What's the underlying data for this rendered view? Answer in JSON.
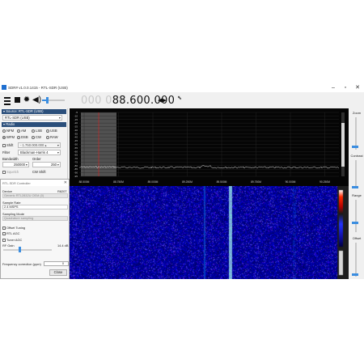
{
  "titlebar": {
    "title": "SDR# v1.0.0.1415 - RTL-SDR (USB)",
    "minimize": "–",
    "maximize": "▫",
    "close": "✕"
  },
  "toolbar": {
    "freq_dim": "000 0",
    "freq_main": "88.600.000",
    "freq_arrows": "◀▶"
  },
  "source": {
    "header": "▾  Source: RTL-SDR (USB)",
    "value": "RTL-SDR (USB)"
  },
  "radio": {
    "header": "▾  Radio",
    "modes": [
      {
        "label": "NFM",
        "on": false
      },
      {
        "label": "AM",
        "on": false
      },
      {
        "label": "LSB",
        "on": false
      },
      {
        "label": "USB",
        "on": false
      },
      {
        "label": "WFM",
        "on": true
      },
      {
        "label": "DSB",
        "on": false
      },
      {
        "label": "CW",
        "on": false
      },
      {
        "label": "RAW",
        "on": false
      }
    ],
    "shift_label": "Shift",
    "shift_value": "- 1.750.000.000 ▴",
    "filter_label": "Filter",
    "filter_value": "Blackman-Harris 4",
    "bandwidth_label": "Bandwidth",
    "order_label": "Order",
    "bandwidth_value": "250000",
    "order_value": "250",
    "squelch_label": "Squelch",
    "cw_shift_label": "CW Shift"
  },
  "dialog": {
    "title": "RTL-SDR Controller",
    "close": "✕",
    "device_label": "Device",
    "device_id": "R820T",
    "device_value": "Generic RTL2832U OEM (0)",
    "sample_rate_label": "Sample Rate",
    "sample_rate_value": "2.4 MSPS",
    "sampling_mode_label": "Sampling Mode",
    "sampling_mode_value": "Quadrature sampling",
    "offset_tuning": "Offset Tuning",
    "rtl_agc": "RTL AGC",
    "tuner_agc": "Tuner AGC",
    "rf_gain_label": "RF Gain",
    "rf_gain_value": "14.4 dB",
    "rf_gain_level": 0.33,
    "freq_correction_label": "Frequency correction (ppm)",
    "freq_correction_value": "0",
    "close_button": "Close"
  },
  "spectrum": {
    "db_ticks": [
      "-5",
      "-10",
      "-15",
      "-20",
      "-25",
      "-30",
      "-35",
      "-40",
      "-45",
      "-50",
      "-55",
      "-60",
      "-65",
      "-70",
      "-75",
      "-80",
      "-85",
      "-90",
      "-95"
    ],
    "freq_ticks": [
      "88.500M",
      "88.750M",
      "89.000M",
      "89.250M",
      "89.500M",
      "89.750M",
      "90.000M",
      "90.250M"
    ]
  },
  "right_panel": {
    "zoom": "Zoom",
    "contrast": "Contrast",
    "range": "Range",
    "offset": "Offset"
  },
  "colors": {
    "accent": "#3a8de0",
    "panel_header": "#2b4f7b",
    "tune_line": "#e02020",
    "trace": "#e8e8e8"
  }
}
